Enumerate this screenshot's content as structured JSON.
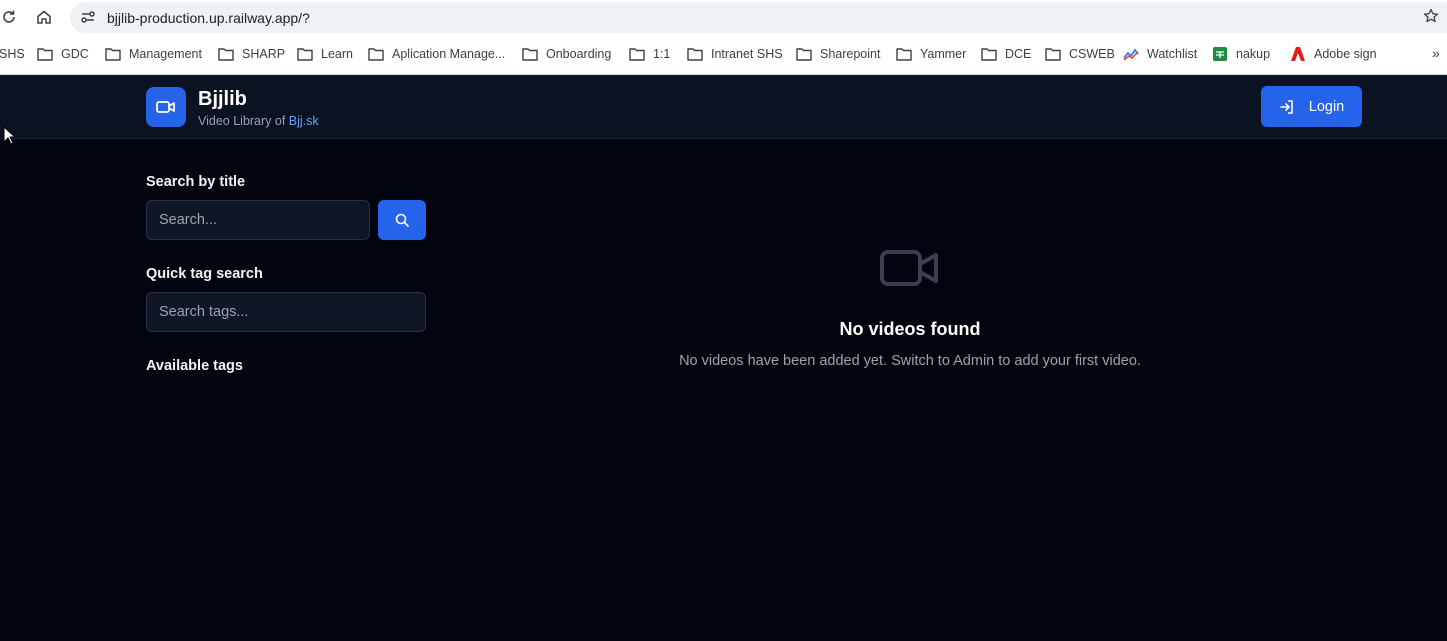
{
  "browser": {
    "url": "bjjlib-production.up.railway.app/?",
    "bookmarks": [
      {
        "label": "SHS",
        "icon": "folder-icon"
      },
      {
        "label": "GDC",
        "icon": "folder-icon"
      },
      {
        "label": "Management",
        "icon": "folder-icon"
      },
      {
        "label": "SHARP",
        "icon": "folder-icon"
      },
      {
        "label": "Learn",
        "icon": "folder-icon"
      },
      {
        "label": "Aplication Manage...",
        "icon": "folder-icon"
      },
      {
        "label": "Onboarding",
        "icon": "folder-icon"
      },
      {
        "label": "1:1",
        "icon": "folder-icon"
      },
      {
        "label": "Intranet SHS",
        "icon": "folder-icon"
      },
      {
        "label": "Sharepoint",
        "icon": "folder-icon"
      },
      {
        "label": "Yammer",
        "icon": "folder-icon"
      },
      {
        "label": "DCE",
        "icon": "folder-icon"
      },
      {
        "label": "CSWEB",
        "icon": "folder-icon"
      },
      {
        "label": "Watchlist",
        "icon": "watchlist-icon"
      },
      {
        "label": "nakup",
        "icon": "sheets-icon"
      },
      {
        "label": "Adobe sign",
        "icon": "adobe-icon"
      }
    ],
    "more": "»"
  },
  "header": {
    "brand_name": "Bjjlib",
    "subtitle_prefix": "Video Library of ",
    "subtitle_link": "Bjj.sk",
    "login_label": "Login",
    "accent_color": "#2563eb"
  },
  "sidebar": {
    "search_label": "Search by title",
    "search_placeholder": "Search...",
    "tag_label": "Quick tag search",
    "tag_placeholder": "Search tags...",
    "available_tags_label": "Available tags"
  },
  "empty_state": {
    "title": "No videos found",
    "description": "No videos have been added yet. Switch to Admin to add your first video."
  }
}
